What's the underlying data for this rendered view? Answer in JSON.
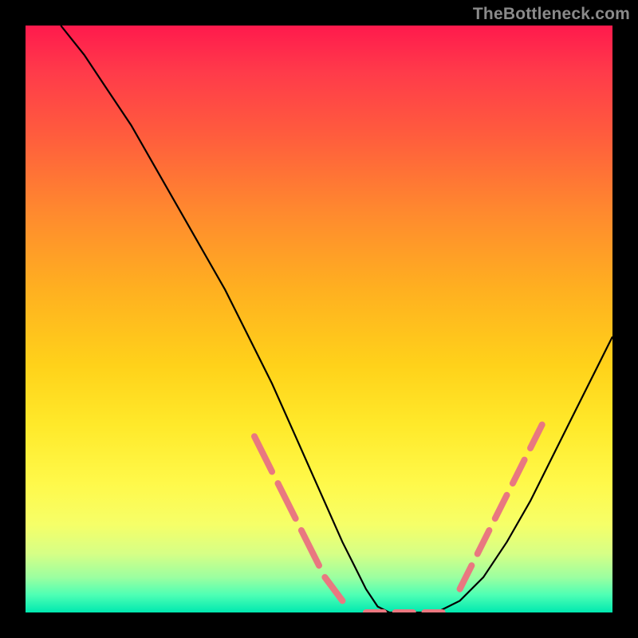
{
  "watermark": "TheBottleneck.com",
  "colors": {
    "curve": "#000000",
    "dashed": "#e97880",
    "background_top": "#ff1a4d",
    "background_bottom": "#00e8b0",
    "frame": "#000000"
  },
  "chart_data": {
    "type": "line",
    "title": "",
    "xlabel": "",
    "ylabel": "",
    "xlim": [
      0,
      100
    ],
    "ylim": [
      0,
      100
    ],
    "grid": false,
    "legend": false,
    "series": [
      {
        "name": "bottleneck-curve",
        "color": "#000000",
        "x": [
          6,
          10,
          14,
          18,
          22,
          26,
          30,
          34,
          38,
          42,
          46,
          50,
          54,
          56,
          58,
          60,
          62,
          66,
          70,
          74,
          78,
          82,
          86,
          90,
          94,
          98,
          100
        ],
        "y": [
          100,
          95,
          89,
          83,
          76,
          69,
          62,
          55,
          47,
          39,
          30,
          21,
          12,
          8,
          4,
          1,
          0,
          0,
          0,
          2,
          6,
          12,
          19,
          27,
          35,
          43,
          47
        ]
      },
      {
        "name": "optimal-region-dashes",
        "style": "dashed",
        "color": "#e97880",
        "segments": [
          {
            "x": [
              39,
              42
            ],
            "y": [
              30,
              24
            ]
          },
          {
            "x": [
              43,
              46
            ],
            "y": [
              22,
              16
            ]
          },
          {
            "x": [
              47,
              50
            ],
            "y": [
              14,
              8
            ]
          },
          {
            "x": [
              51,
              54
            ],
            "y": [
              6,
              2
            ]
          },
          {
            "x": [
              58,
              61
            ],
            "y": [
              0,
              0
            ]
          },
          {
            "x": [
              63,
              66
            ],
            "y": [
              0,
              0
            ]
          },
          {
            "x": [
              68,
              71
            ],
            "y": [
              0,
              0
            ]
          },
          {
            "x": [
              74,
              76
            ],
            "y": [
              4,
              8
            ]
          },
          {
            "x": [
              77,
              79
            ],
            "y": [
              10,
              14
            ]
          },
          {
            "x": [
              80,
              82
            ],
            "y": [
              16,
              20
            ]
          },
          {
            "x": [
              83,
              85
            ],
            "y": [
              22,
              26
            ]
          },
          {
            "x": [
              86,
              88
            ],
            "y": [
              28,
              32
            ]
          }
        ]
      }
    ]
  }
}
